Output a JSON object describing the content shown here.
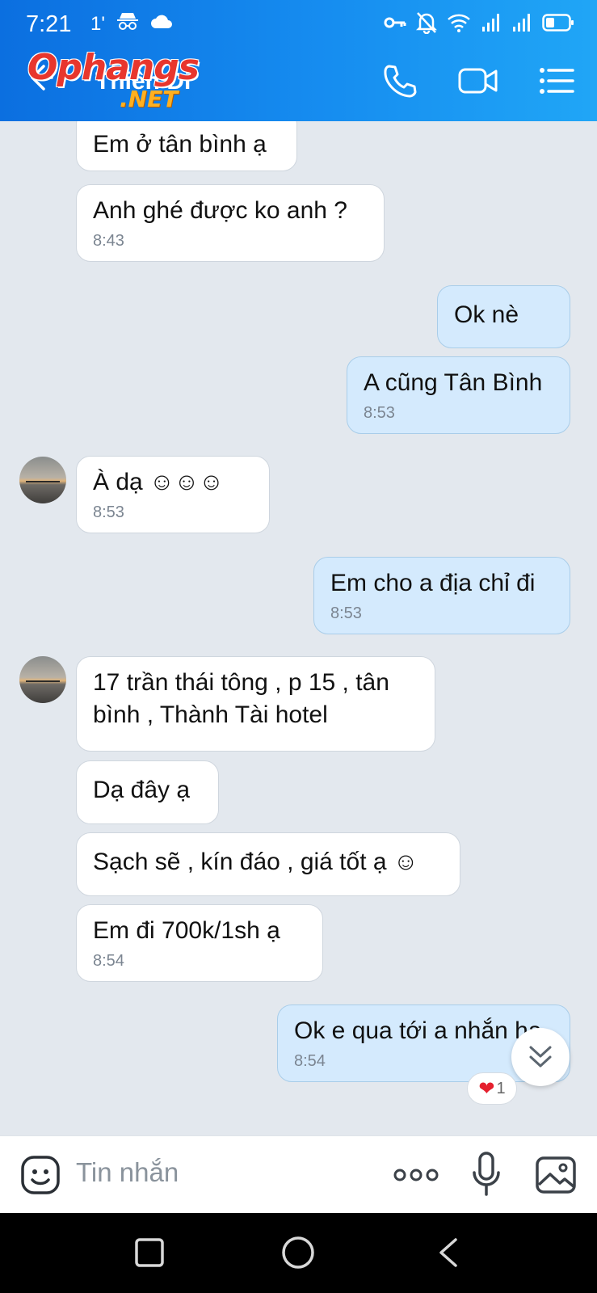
{
  "status_bar": {
    "time": "7:21",
    "indicator": "1'",
    "icons": [
      "incognito-icon",
      "cloud-icon",
      "key-icon",
      "bell-off-icon",
      "wifi-icon",
      "signal-icon",
      "signal-icon",
      "battery-icon"
    ]
  },
  "header": {
    "contact_name": "Thiên Di",
    "watermark_main": "Ophangs",
    "watermark_sub": ".NET",
    "actions": [
      "phone-icon",
      "video-icon",
      "menu-icon"
    ]
  },
  "messages": [
    {
      "dir": "in",
      "text": "Em ở tân bình ạ",
      "time": ""
    },
    {
      "dir": "in",
      "text": "Anh ghé được ko anh ?",
      "time": "8:43"
    },
    {
      "dir": "out",
      "text": "Ok nè",
      "time": ""
    },
    {
      "dir": "out",
      "text": "A cũng Tân Bình",
      "time": "8:53"
    },
    {
      "dir": "in",
      "text": "À dạ ☺☺☺",
      "time": "8:53"
    },
    {
      "dir": "out",
      "text": "Em cho a địa chỉ đi",
      "time": "8:53"
    },
    {
      "dir": "in",
      "text": "17 trần thái tông , p 15 , tân bình , Thành Tài hotel",
      "time": ""
    },
    {
      "dir": "in",
      "text": "Dạ đây ạ",
      "time": ""
    },
    {
      "dir": "in",
      "text": "Sạch sẽ , kín đáo , giá tốt ạ ☺",
      "time": ""
    },
    {
      "dir": "in",
      "text": "Em đi 700k/1sh ạ",
      "time": "8:54"
    },
    {
      "dir": "out",
      "text": "Ok e qua tới a nhắn ha",
      "time": "8:54"
    }
  ],
  "reaction": {
    "emoji": "❤",
    "count": "1"
  },
  "input_bar": {
    "placeholder": "Tin nhắn"
  },
  "colors": {
    "header_start": "#0b6fe0",
    "header_end": "#20a6f6",
    "chat_bg": "#e3e8ee",
    "outgoing_bubble": "#d4eafd",
    "incoming_bubble": "#ffffff",
    "heart": "#e5202e"
  }
}
